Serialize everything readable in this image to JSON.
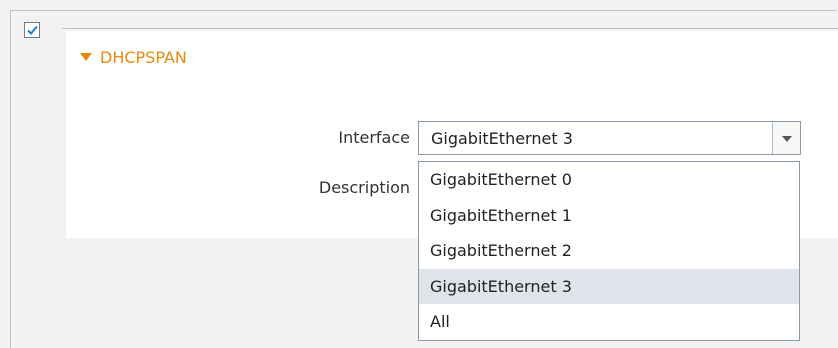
{
  "section": {
    "title": "DHCPSPAN",
    "enabled": true
  },
  "form": {
    "interface_label": "Interface",
    "description_label": "Description",
    "interface_value": "GigabitEthernet 3"
  },
  "dropdown": {
    "options": [
      {
        "label": "GigabitEthernet 0",
        "selected": false
      },
      {
        "label": "GigabitEthernet 1",
        "selected": false
      },
      {
        "label": "GigabitEthernet 2",
        "selected": false
      },
      {
        "label": "GigabitEthernet 3",
        "selected": true
      },
      {
        "label": "All",
        "selected": false
      }
    ]
  },
  "colors": {
    "accent": "#e8890d",
    "selected_option_bg": "#dfe4ea",
    "checkbox_check": "#1f7fd0"
  },
  "icons": {
    "checkbox": "checkmark-icon",
    "section_toggle": "triangle-down-icon",
    "select_arrow": "chevron-down-icon"
  }
}
